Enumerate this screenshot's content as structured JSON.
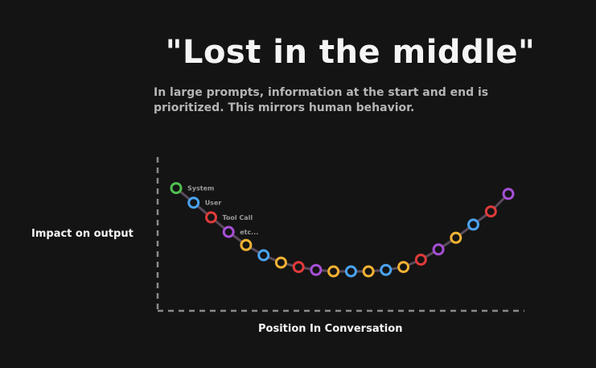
{
  "title": "\"Lost in the middle\"",
  "subtitle": "In large prompts, information at the start and end is prioritized. This mirrors human behavior.",
  "axes": {
    "ylabel": "Impact on output",
    "xlabel": "Position In Conversation"
  },
  "point_labels": [
    "System",
    "User",
    "Tool Call",
    "etc..."
  ],
  "colors": {
    "background": "#141414",
    "axis": "#8a8a8a",
    "curve": "#5a4a5a",
    "label": "#9a9a9a",
    "green": "#4fbf4f",
    "blue": "#4aa3f0",
    "red": "#e03a3a",
    "purple": "#a64fd6",
    "yellow": "#f2b233"
  },
  "chart_data": {
    "type": "scatter",
    "title": "\"Lost in the middle\"",
    "xlabel": "Position In Conversation",
    "ylabel": "Impact on output",
    "x": [
      1,
      2,
      3,
      4,
      5,
      6,
      7,
      8,
      9,
      10,
      11,
      12,
      13,
      14,
      15,
      16,
      17,
      18,
      19,
      20
    ],
    "y": [
      0.84,
      0.74,
      0.64,
      0.54,
      0.45,
      0.38,
      0.33,
      0.3,
      0.28,
      0.27,
      0.27,
      0.27,
      0.28,
      0.3,
      0.35,
      0.42,
      0.5,
      0.59,
      0.68,
      0.8
    ],
    "point_colors": [
      "green",
      "blue",
      "red",
      "purple",
      "yellow",
      "blue",
      "yellow",
      "red",
      "purple",
      "yellow",
      "blue",
      "yellow",
      "blue",
      "yellow",
      "red",
      "purple",
      "yellow",
      "blue",
      "red",
      "purple"
    ],
    "grid": false,
    "legend": "none"
  }
}
